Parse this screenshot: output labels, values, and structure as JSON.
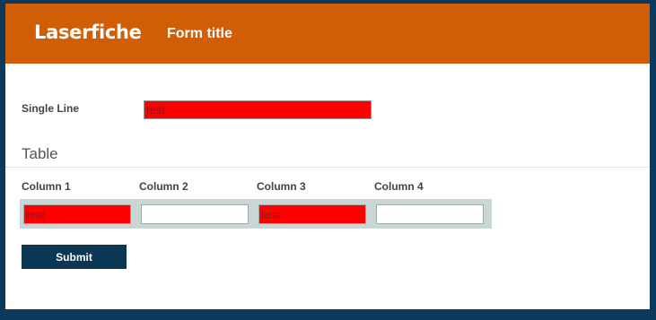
{
  "header": {
    "logo_text": "Laserfiche",
    "form_title": "Form title"
  },
  "single_line": {
    "label": "Single Line",
    "value": "test"
  },
  "table": {
    "heading": "Table",
    "columns": [
      "Column 1",
      "Column 2",
      "Column 3",
      "Column 4"
    ],
    "rows": [
      {
        "cells": [
          "test",
          "",
          "test",
          ""
        ]
      }
    ]
  },
  "submit_label": "Submit",
  "colors": {
    "header_bg": "#d05e06",
    "page_bg": "#0d3a5c",
    "error_field_bg": "#ff0000",
    "table_row_bg": "#c9d6d6",
    "submit_bg": "#0b3755"
  }
}
